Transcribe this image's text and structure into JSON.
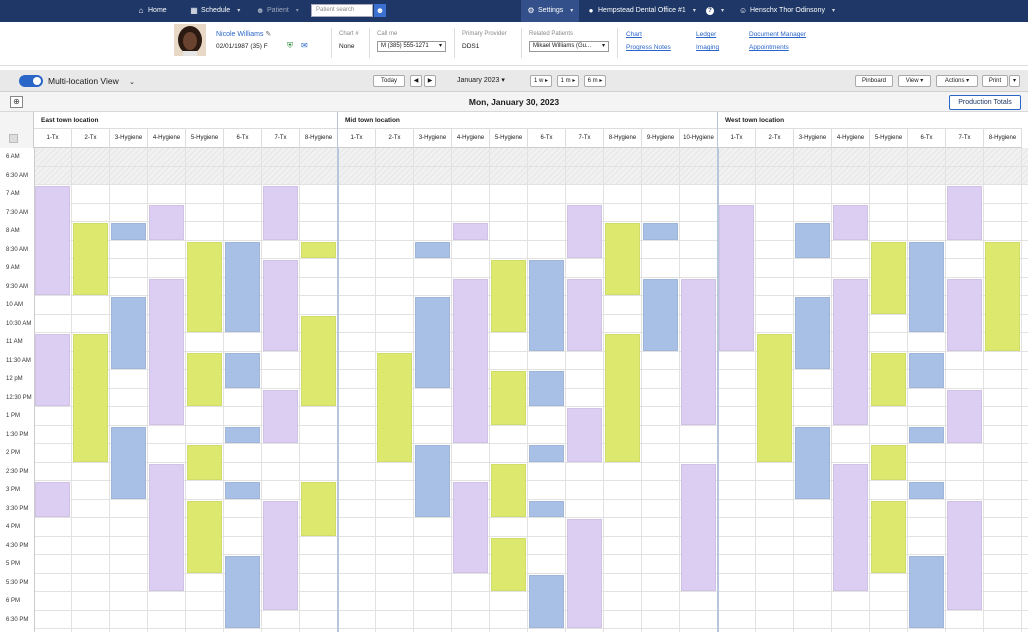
{
  "nav": {
    "home": "Home",
    "schedule": "Schedule",
    "patient": "Patient",
    "search_placeholder": "Patient search",
    "settings": "Settings",
    "office": "Hempstead Dental Office #1",
    "help": "?",
    "user": "Henschx Thor Odinsony"
  },
  "patient": {
    "name": "Nicole Williams",
    "dob": "02/01/1987 (35) F",
    "chart_label": "Chart #",
    "chart_value": "None",
    "call_label": "Call me",
    "call_value": "M (385) 555-1271",
    "provider_label": "Primary Provider",
    "provider_value": "DDS1",
    "related_label": "Related Patients",
    "related_value": "Mikael Williams (Gu...",
    "links": [
      "Chart",
      "Ledger",
      "Document Manager",
      "Progress Notes",
      "Imaging",
      "Appointments"
    ]
  },
  "toolbar": {
    "view_label": "Multi-location View",
    "today": "Today",
    "month": "January 2023",
    "range_buttons": [
      "1 w",
      "1 m",
      "6 m"
    ],
    "pinboard": "Pinboard",
    "view": "View",
    "actions": "Actions",
    "print": "Print"
  },
  "date_title": "Mon, January 30, 2023",
  "production_totals": "Production Totals",
  "times": [
    "6 AM",
    "6:30 AM",
    "7 AM",
    "7:30 AM",
    "8 AM",
    "8:30 AM",
    "9 AM",
    "9:30 AM",
    "10 AM",
    "10:30 AM",
    "11 AM",
    "11:30 AM",
    "12 pM",
    "12:30 PM",
    "1 PM",
    "1:30 PM",
    "2 PM",
    "2:30 PM",
    "3 PM",
    "3:30 PM",
    "4 PM",
    "4:30 PM",
    "5 PM",
    "5:30 PM",
    "6 PM",
    "6:30 PM"
  ],
  "colors": {
    "purple": "#dccdf2",
    "green": "#dce96e",
    "blue": "#a8bfe6",
    "navy": "#1e3766",
    "accent": "#2a66c8"
  },
  "locations": [
    {
      "name": "East town location",
      "columns": [
        "1-Tx",
        "2-Tx",
        "3-Hygiene",
        "4-Hygiene",
        "5-Hygiene",
        "6-Tx",
        "7-Tx",
        "8-Hygiene"
      ],
      "appointments": [
        {
          "col": 0,
          "start": "7 AM",
          "end": "10 AM",
          "color": "purple"
        },
        {
          "col": 0,
          "start": "11 AM",
          "end": "1 PM",
          "color": "purple"
        },
        {
          "col": 0,
          "start": "3 PM",
          "end": "4 PM",
          "color": "purple"
        },
        {
          "col": 1,
          "start": "8 AM",
          "end": "10 AM",
          "color": "green"
        },
        {
          "col": 1,
          "start": "11 AM",
          "end": "2:30 PM",
          "color": "green"
        },
        {
          "col": 2,
          "start": "8 AM",
          "end": "8:30 AM",
          "color": "blue"
        },
        {
          "col": 2,
          "start": "10 AM",
          "end": "12 pM",
          "color": "blue"
        },
        {
          "col": 2,
          "start": "1:30 PM",
          "end": "3:30 PM",
          "color": "blue"
        },
        {
          "col": 3,
          "start": "7:30 AM",
          "end": "8:30 AM",
          "color": "purple"
        },
        {
          "col": 3,
          "start": "9:30 AM",
          "end": "1:30 PM",
          "color": "purple"
        },
        {
          "col": 3,
          "start": "2:30 PM",
          "end": "6 PM",
          "color": "purple"
        },
        {
          "col": 4,
          "start": "8:30 AM",
          "end": "11 AM",
          "color": "green"
        },
        {
          "col": 4,
          "start": "11:30 AM",
          "end": "1 PM",
          "color": "green"
        },
        {
          "col": 4,
          "start": "2 PM",
          "end": "3 PM",
          "color": "green"
        },
        {
          "col": 4,
          "start": "3:30 PM",
          "end": "5:30 PM",
          "color": "green"
        },
        {
          "col": 5,
          "start": "8:30 AM",
          "end": "11 AM",
          "color": "blue"
        },
        {
          "col": 5,
          "start": "11:30 AM",
          "end": "12:30 PM",
          "color": "blue"
        },
        {
          "col": 5,
          "start": "1:30 PM",
          "end": "2 PM",
          "color": "blue"
        },
        {
          "col": 5,
          "start": "3 PM",
          "end": "3:30 PM",
          "color": "blue"
        },
        {
          "col": 5,
          "start": "5 PM",
          "end": "7 PM",
          "color": "blue"
        },
        {
          "col": 6,
          "start": "7 AM",
          "end": "8:30 AM",
          "color": "purple"
        },
        {
          "col": 6,
          "start": "9 AM",
          "end": "11:30 AM",
          "color": "purple"
        },
        {
          "col": 6,
          "start": "12:30 PM",
          "end": "2 PM",
          "color": "purple"
        },
        {
          "col": 6,
          "start": "3:30 PM",
          "end": "6:30 PM",
          "color": "purple"
        },
        {
          "col": 7,
          "start": "8:30 AM",
          "end": "9 AM",
          "color": "green"
        },
        {
          "col": 7,
          "start": "10:30 AM",
          "end": "1 PM",
          "color": "green"
        },
        {
          "col": 7,
          "start": "3 PM",
          "end": "4:30 PM",
          "color": "green"
        }
      ]
    },
    {
      "name": "Mid town location",
      "columns": [
        "1-Tx",
        "2-Tx",
        "3-Hygiene",
        "4-Hygiene",
        "5-Hygiene",
        "6-Tx",
        "7-Tx",
        "8-Hygiene",
        "9-Hygiene",
        "10-Hygiene"
      ],
      "appointments": [
        {
          "col": 1,
          "start": "11:30 AM",
          "end": "2:30 PM",
          "color": "green"
        },
        {
          "col": 2,
          "start": "8:30 AM",
          "end": "9 AM",
          "color": "blue"
        },
        {
          "col": 2,
          "start": "10 AM",
          "end": "12:30 PM",
          "color": "blue"
        },
        {
          "col": 2,
          "start": "2 PM",
          "end": "4 PM",
          "color": "blue"
        },
        {
          "col": 3,
          "start": "8 AM",
          "end": "8:30 AM",
          "color": "purple"
        },
        {
          "col": 3,
          "start": "9:30 AM",
          "end": "2 PM",
          "color": "purple"
        },
        {
          "col": 3,
          "start": "3 PM",
          "end": "5:30 PM",
          "color": "purple"
        },
        {
          "col": 4,
          "start": "9 AM",
          "end": "11 AM",
          "color": "green"
        },
        {
          "col": 4,
          "start": "12 pM",
          "end": "1:30 PM",
          "color": "green"
        },
        {
          "col": 4,
          "start": "2:30 PM",
          "end": "4 PM",
          "color": "green"
        },
        {
          "col": 4,
          "start": "4:30 PM",
          "end": "6 PM",
          "color": "green"
        },
        {
          "col": 5,
          "start": "9 AM",
          "end": "11:30 AM",
          "color": "blue"
        },
        {
          "col": 5,
          "start": "12 pM",
          "end": "1 PM",
          "color": "blue"
        },
        {
          "col": 5,
          "start": "2 PM",
          "end": "2:30 PM",
          "color": "blue"
        },
        {
          "col": 5,
          "start": "3:30 PM",
          "end": "4 PM",
          "color": "blue"
        },
        {
          "col": 5,
          "start": "5:30 PM",
          "end": "7 PM",
          "color": "blue"
        },
        {
          "col": 6,
          "start": "7:30 AM",
          "end": "9 AM",
          "color": "purple"
        },
        {
          "col": 6,
          "start": "9:30 AM",
          "end": "11:30 AM",
          "color": "purple"
        },
        {
          "col": 6,
          "start": "1 PM",
          "end": "2:30 PM",
          "color": "purple"
        },
        {
          "col": 6,
          "start": "4 PM",
          "end": "7 PM",
          "color": "purple"
        },
        {
          "col": 7,
          "start": "8 AM",
          "end": "10 AM",
          "color": "green"
        },
        {
          "col": 7,
          "start": "11 AM",
          "end": "2:30 PM",
          "color": "green"
        },
        {
          "col": 8,
          "start": "8 AM",
          "end": "8:30 AM",
          "color": "blue"
        },
        {
          "col": 8,
          "start": "9:30 AM",
          "end": "11:30 AM",
          "color": "blue"
        },
        {
          "col": 9,
          "start": "9:30 AM",
          "end": "1:30 PM",
          "color": "purple"
        },
        {
          "col": 9,
          "start": "2:30 PM",
          "end": "6 PM",
          "color": "purple"
        }
      ]
    },
    {
      "name": "West town location",
      "columns": [
        "1-Tx",
        "2-Tx",
        "3-Hygiene",
        "4-Hygiene",
        "5-Hygiene",
        "6-Tx",
        "7-Tx",
        "8-Hygiene"
      ],
      "appointments": [
        {
          "col": 0,
          "start": "7:30 AM",
          "end": "11:30 AM",
          "color": "purple"
        },
        {
          "col": 1,
          "start": "11 AM",
          "end": "2:30 PM",
          "color": "green"
        },
        {
          "col": 2,
          "start": "8 AM",
          "end": "9 AM",
          "color": "blue"
        },
        {
          "col": 2,
          "start": "10 AM",
          "end": "12 pM",
          "color": "blue"
        },
        {
          "col": 2,
          "start": "1:30 PM",
          "end": "3:30 PM",
          "color": "blue"
        },
        {
          "col": 3,
          "start": "7:30 AM",
          "end": "8:30 AM",
          "color": "purple"
        },
        {
          "col": 3,
          "start": "9:30 AM",
          "end": "1:30 PM",
          "color": "purple"
        },
        {
          "col": 3,
          "start": "2:30 PM",
          "end": "6 PM",
          "color": "purple"
        },
        {
          "col": 4,
          "start": "8:30 AM",
          "end": "10:30 AM",
          "color": "green"
        },
        {
          "col": 4,
          "start": "11:30 AM",
          "end": "1 PM",
          "color": "green"
        },
        {
          "col": 4,
          "start": "2 PM",
          "end": "3 PM",
          "color": "green"
        },
        {
          "col": 4,
          "start": "3:30 PM",
          "end": "5:30 PM",
          "color": "green"
        },
        {
          "col": 5,
          "start": "8:30 AM",
          "end": "11 AM",
          "color": "blue"
        },
        {
          "col": 5,
          "start": "11:30 AM",
          "end": "12:30 PM",
          "color": "blue"
        },
        {
          "col": 5,
          "start": "1:30 PM",
          "end": "2 PM",
          "color": "blue"
        },
        {
          "col": 5,
          "start": "3 PM",
          "end": "3:30 PM",
          "color": "blue"
        },
        {
          "col": 5,
          "start": "5 PM",
          "end": "7 PM",
          "color": "blue"
        },
        {
          "col": 6,
          "start": "7 AM",
          "end": "8:30 AM",
          "color": "purple"
        },
        {
          "col": 6,
          "start": "9:30 AM",
          "end": "11:30 AM",
          "color": "purple"
        },
        {
          "col": 6,
          "start": "12:30 PM",
          "end": "2 PM",
          "color": "purple"
        },
        {
          "col": 6,
          "start": "3:30 PM",
          "end": "6:30 PM",
          "color": "purple"
        },
        {
          "col": 7,
          "start": "8:30 AM",
          "end": "11:30 AM",
          "color": "green"
        }
      ]
    }
  ]
}
